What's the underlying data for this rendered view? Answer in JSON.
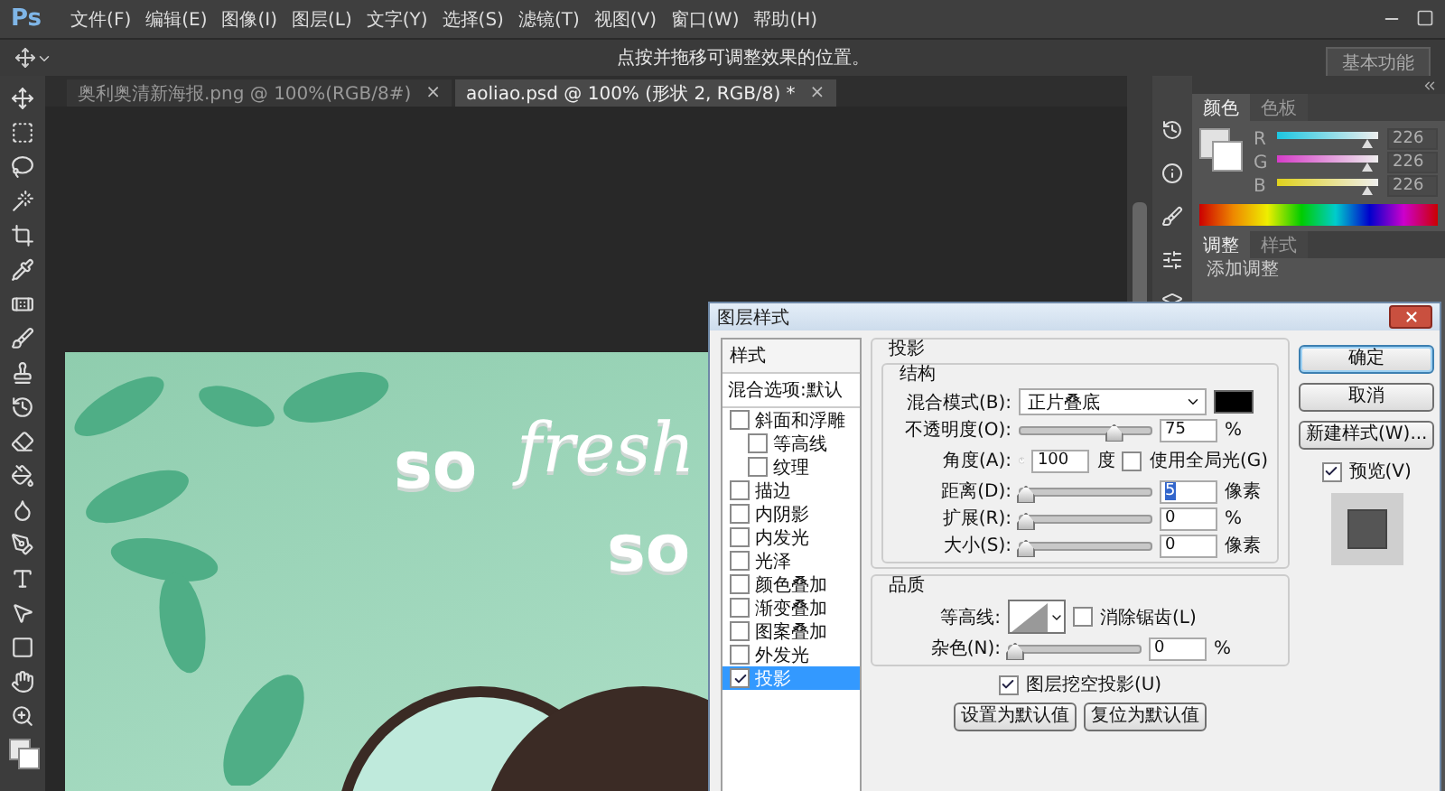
{
  "app": {
    "logo": "Ps"
  },
  "menu": [
    "文件(F)",
    "编辑(E)",
    "图像(I)",
    "图层(L)",
    "文字(Y)",
    "选择(S)",
    "滤镜(T)",
    "视图(V)",
    "窗口(W)",
    "帮助(H)"
  ],
  "options_bar": {
    "hint": "点按并拖移可调整效果的位置。",
    "workspace": "基本功能"
  },
  "doc_tabs": [
    {
      "label": "奥利奥清新海报.png @ 100%(RGB/8#)",
      "close": "×",
      "selected": false
    },
    {
      "label": "aoliao.psd @ 100% (形状 2, RGB/8) *",
      "close": "×",
      "selected": true
    }
  ],
  "canvas": {
    "texts": [
      {
        "text": "so",
        "kind": "bold"
      },
      {
        "text": "fresh",
        "kind": "script"
      },
      {
        "text": "so",
        "kind": "bold"
      }
    ]
  },
  "color_panel": {
    "tabs": [
      {
        "label": "颜色",
        "selected": true
      },
      {
        "label": "色板",
        "selected": false
      }
    ],
    "channels": [
      {
        "name": "R",
        "value": "226",
        "level": 0.89
      },
      {
        "name": "G",
        "value": "226",
        "level": 0.89
      },
      {
        "name": "B",
        "value": "226",
        "level": 0.89
      }
    ]
  },
  "adjust_panel": {
    "tabs": [
      {
        "label": "调整",
        "selected": true
      },
      {
        "label": "样式",
        "selected": false
      }
    ],
    "hint": "添加调整"
  },
  "dialog": {
    "title": "图层样式",
    "styles_header": "样式",
    "blend_options": "混合选项:默认",
    "effects": [
      {
        "label": "斜面和浮雕",
        "checked": false,
        "selected": false,
        "children": [
          {
            "label": "等高线",
            "checked": false,
            "selected": false
          },
          {
            "label": "纹理",
            "checked": false,
            "selected": false
          }
        ]
      },
      {
        "label": "描边",
        "checked": false,
        "selected": false
      },
      {
        "label": "内阴影",
        "checked": false,
        "selected": false
      },
      {
        "label": "内发光",
        "checked": false,
        "selected": false
      },
      {
        "label": "光泽",
        "checked": false,
        "selected": false
      },
      {
        "label": "颜色叠加",
        "checked": false,
        "selected": false
      },
      {
        "label": "渐变叠加",
        "checked": false,
        "selected": false
      },
      {
        "label": "图案叠加",
        "checked": false,
        "selected": false
      },
      {
        "label": "外发光",
        "checked": false,
        "selected": false
      },
      {
        "label": "投影",
        "checked": true,
        "selected": true
      }
    ],
    "section": "投影",
    "structure": {
      "legend": "结构",
      "rows": [
        {
          "kind": "select",
          "label": "混合模式(B):",
          "value": "正片叠底"
        },
        {
          "kind": "slider",
          "label": "不透明度(O):",
          "level": 0.75,
          "value": "75",
          "unit": "%",
          "focused": false
        },
        {
          "kind": "angle",
          "label": "角度(A):",
          "value": "100",
          "unit": "度",
          "option": {
            "label": "使用全局光(G)",
            "checked": false
          }
        },
        {
          "kind": "slider",
          "label": "距离(D):",
          "level": 0,
          "value": "5",
          "unit": "像素",
          "focused": true
        },
        {
          "kind": "slider",
          "label": "扩展(R):",
          "level": 0,
          "value": "0",
          "unit": "%",
          "focused": false
        },
        {
          "kind": "slider",
          "label": "大小(S):",
          "level": 0,
          "value": "0",
          "unit": "像素",
          "focused": false
        }
      ]
    },
    "quality": {
      "legend": "品质",
      "contour_label": "等高线:",
      "antialias": {
        "label": "消除锯齿(L)",
        "checked": false
      },
      "noise": {
        "label": "杂色(N):",
        "level": 0,
        "value": "0",
        "unit": "%"
      }
    },
    "knockout": {
      "label": "图层挖空投影(U)",
      "checked": true
    },
    "default_buttons": [
      "设置为默认值",
      "复位为默认值"
    ],
    "buttons": [
      {
        "label": "确定",
        "primary": true
      },
      {
        "label": "取消",
        "primary": false
      },
      {
        "label": "新建样式(W)...",
        "primary": false
      }
    ],
    "preview": {
      "label": "预览(V)",
      "checked": true
    }
  }
}
